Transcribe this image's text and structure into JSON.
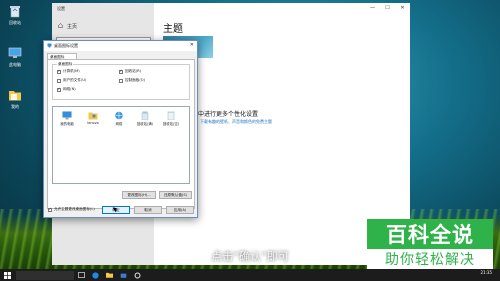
{
  "desktop": {
    "icons": [
      {
        "label": "回收站",
        "icon": "recycle-bin-icon"
      },
      {
        "label": "此电脑",
        "icon": "computer-icon"
      },
      {
        "label": "我的",
        "icon": "folder-icon"
      }
    ]
  },
  "settings": {
    "window_title": "设置",
    "home_label": "主页",
    "heading": "主题",
    "personalize_title": "中进行更多个性化设置",
    "personalize_sub": "下载有趣的壁纸、声音和颜色的免费主题",
    "controls": [
      "—",
      "☐",
      "✕"
    ]
  },
  "dialog": {
    "title": "桌面图标设置",
    "tab": "桌面图标",
    "group_label": "桌面图标",
    "checkboxes": [
      {
        "label": "计算机(M)",
        "checked": true
      },
      {
        "label": "回收站(R)",
        "checked": true
      },
      {
        "label": "用户的文件(U)",
        "checked": false
      },
      {
        "label": "控制面板(O)",
        "checked": false
      },
      {
        "label": "网络(N)",
        "checked": true
      }
    ],
    "icons": [
      {
        "label": "我的电脑",
        "icon": "computer-icon"
      },
      {
        "label": "lenovo",
        "icon": "user-folder-icon"
      },
      {
        "label": "网络",
        "icon": "network-icon"
      },
      {
        "label": "回收站(满)",
        "icon": "recycle-bin-full-icon"
      },
      {
        "label": "回收站(空)",
        "icon": "recycle-bin-empty-icon"
      }
    ],
    "change_icon": "更改图标(H)...",
    "restore_default": "还原默认值(S)",
    "allow_theme": "允许主题更改桌面图标(L)",
    "ok": "确定",
    "cancel": "取消",
    "apply": "应用(A)"
  },
  "watermark": {
    "top": "百科全说",
    "bottom": "助你轻松解决"
  },
  "caption": "点击“确认”即可",
  "taskbar": {
    "search_placeholder": "",
    "time": "21:35",
    "date": ""
  },
  "colors": {
    "accent": "#0078d7",
    "watermark_green": "#2fb24a"
  }
}
